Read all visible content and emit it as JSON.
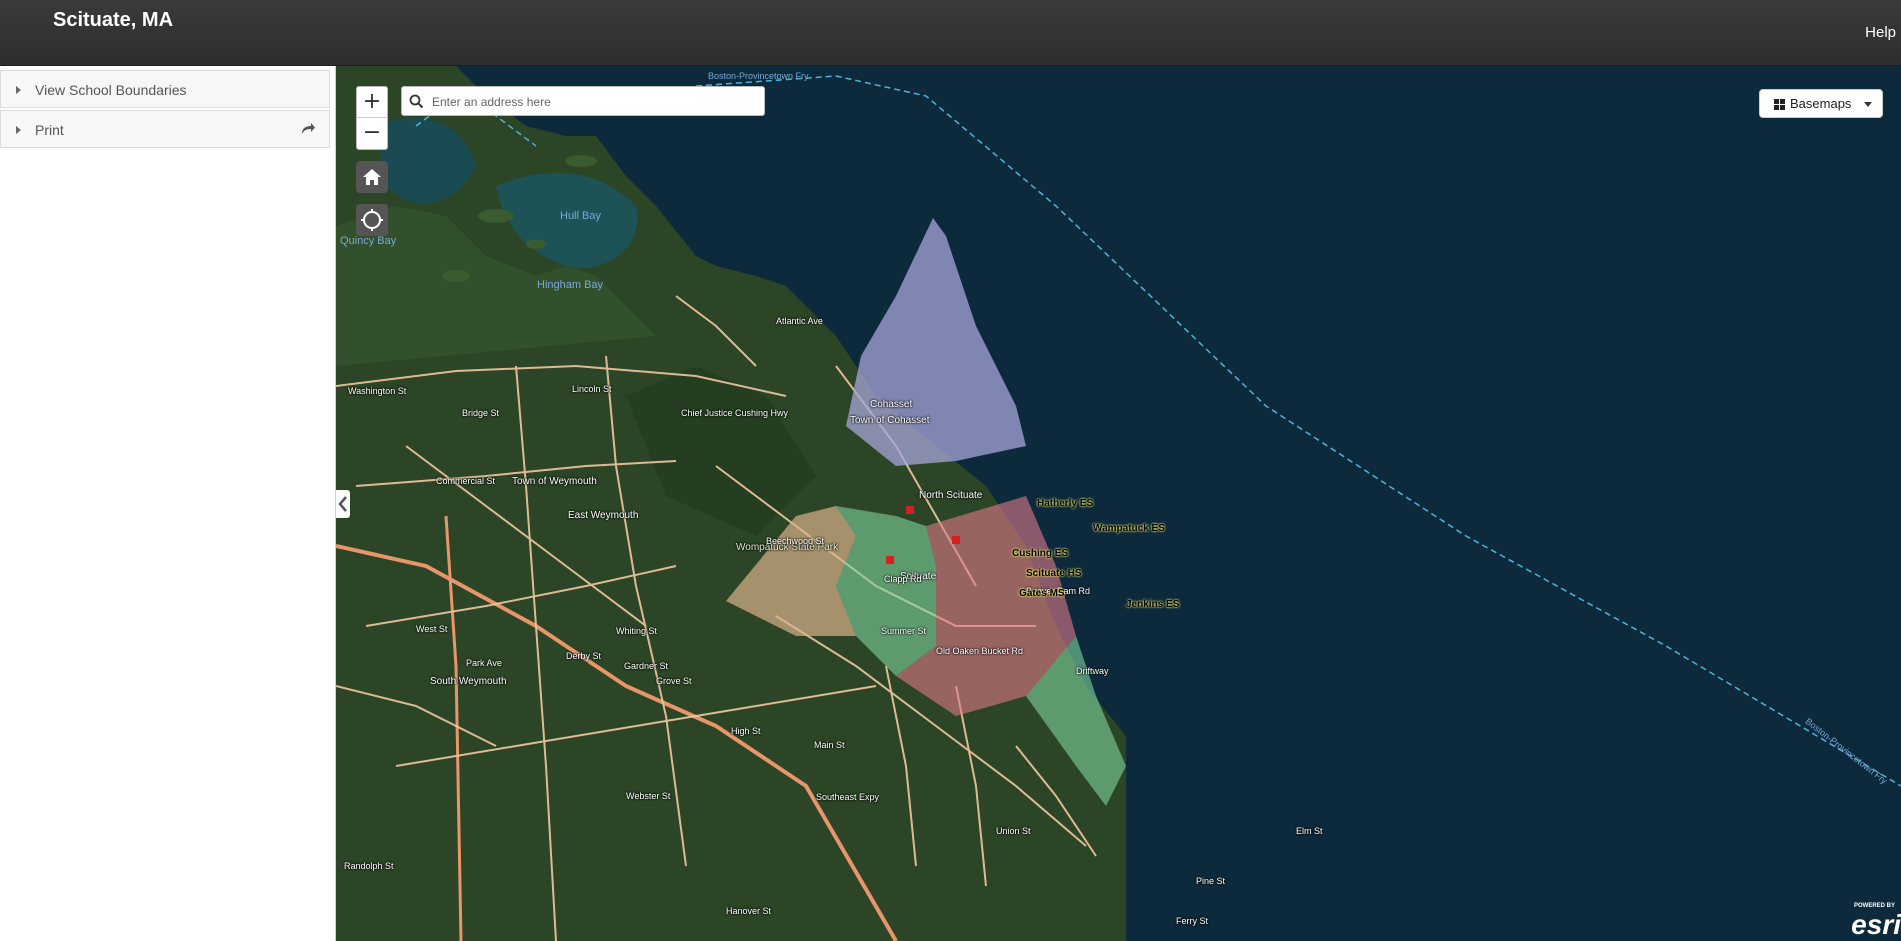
{
  "header": {
    "title": "Scituate, MA",
    "help_label": "Help"
  },
  "sidebar": {
    "items": [
      {
        "label": "View School Boundaries",
        "icon": "caret-right-icon"
      },
      {
        "label": "Print",
        "icon": "caret-right-icon",
        "action_icon": "share-icon"
      }
    ]
  },
  "map": {
    "zoom_in": "+",
    "zoom_out": "−",
    "search_placeholder": "Enter an address here",
    "basemaps_label": "Basemaps",
    "logo": {
      "powered": "POWERED BY",
      "word": "esri"
    },
    "water_labels": [
      "Hull Bay",
      "Hingham Bay",
      "Quincy Bay",
      "Boston-Provincetown Fry",
      "Boston-Provincetown Fry"
    ],
    "towns": [
      "Cohasset",
      "Town of Cohasset",
      "North Scituate",
      "Town of Weymouth",
      "East Weymouth",
      "South Weymouth",
      "Wompatuck State Park",
      "Scituate"
    ],
    "roads": [
      "Lincoln St",
      "Bridge St",
      "Commercial St",
      "Washington St",
      "Chief Justice Cushing Hwy",
      "Main St",
      "Southeast Expy",
      "Summer St",
      "Clapp Rd",
      "Old Oaken Bucket Rd",
      "Driftway",
      "Beaver Dam Rd",
      "Union St",
      "Hanover St",
      "Webster St",
      "Grove St",
      "High St",
      "Derby St",
      "Pine St",
      "Ferry St",
      "Elm St",
      "Atlantic Ave",
      "Beechwood St",
      "Randolph St",
      "Park Ave",
      "West St",
      "Whiting St",
      "Gardner St"
    ],
    "schools": [
      "Hatherly ES",
      "Wampatuck ES",
      "Cushing ES",
      "Scituate HS",
      "Gates MS",
      "Jenkins ES"
    ],
    "colors": {
      "header_bg": "#333333",
      "water": "#0c2a3c",
      "land": "#2f4a2a",
      "road": "#f0c8a0",
      "highway": "#e8956a",
      "zone_purple": "#a6a6d8",
      "zone_tan": "#d8b48a",
      "zone_green": "#7fd6a0",
      "zone_red": "#e07a8a",
      "ferry_line": "#4fb3d9"
    }
  }
}
